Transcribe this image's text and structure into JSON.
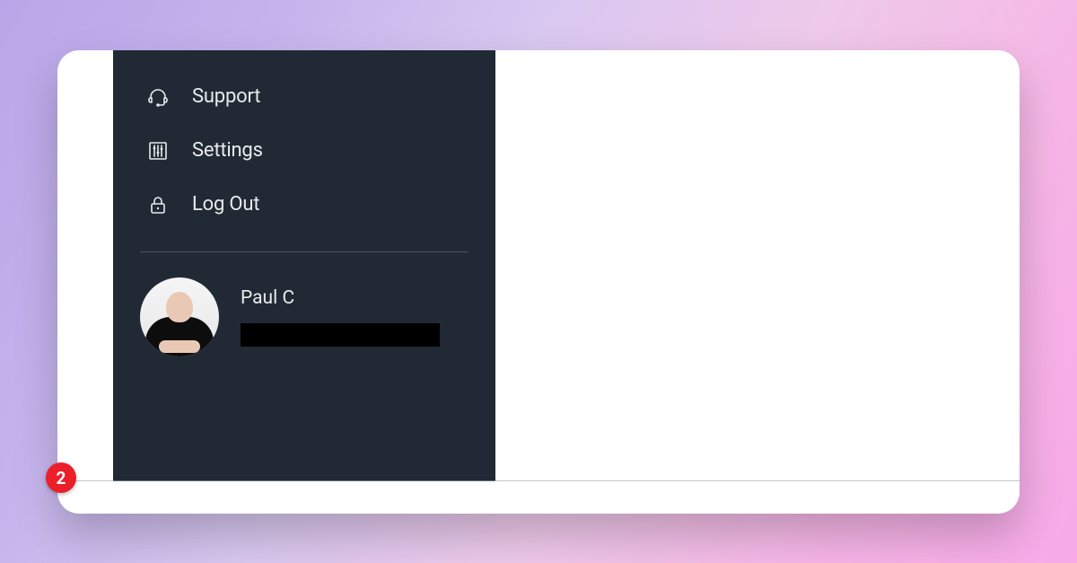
{
  "sidebar": {
    "items": [
      {
        "label": "Support",
        "icon": "headset-icon"
      },
      {
        "label": "Settings",
        "icon": "sliders-icon"
      },
      {
        "label": "Log Out",
        "icon": "lock-icon"
      }
    ]
  },
  "user": {
    "name": "Paul C"
  },
  "badge": {
    "count": "2"
  }
}
